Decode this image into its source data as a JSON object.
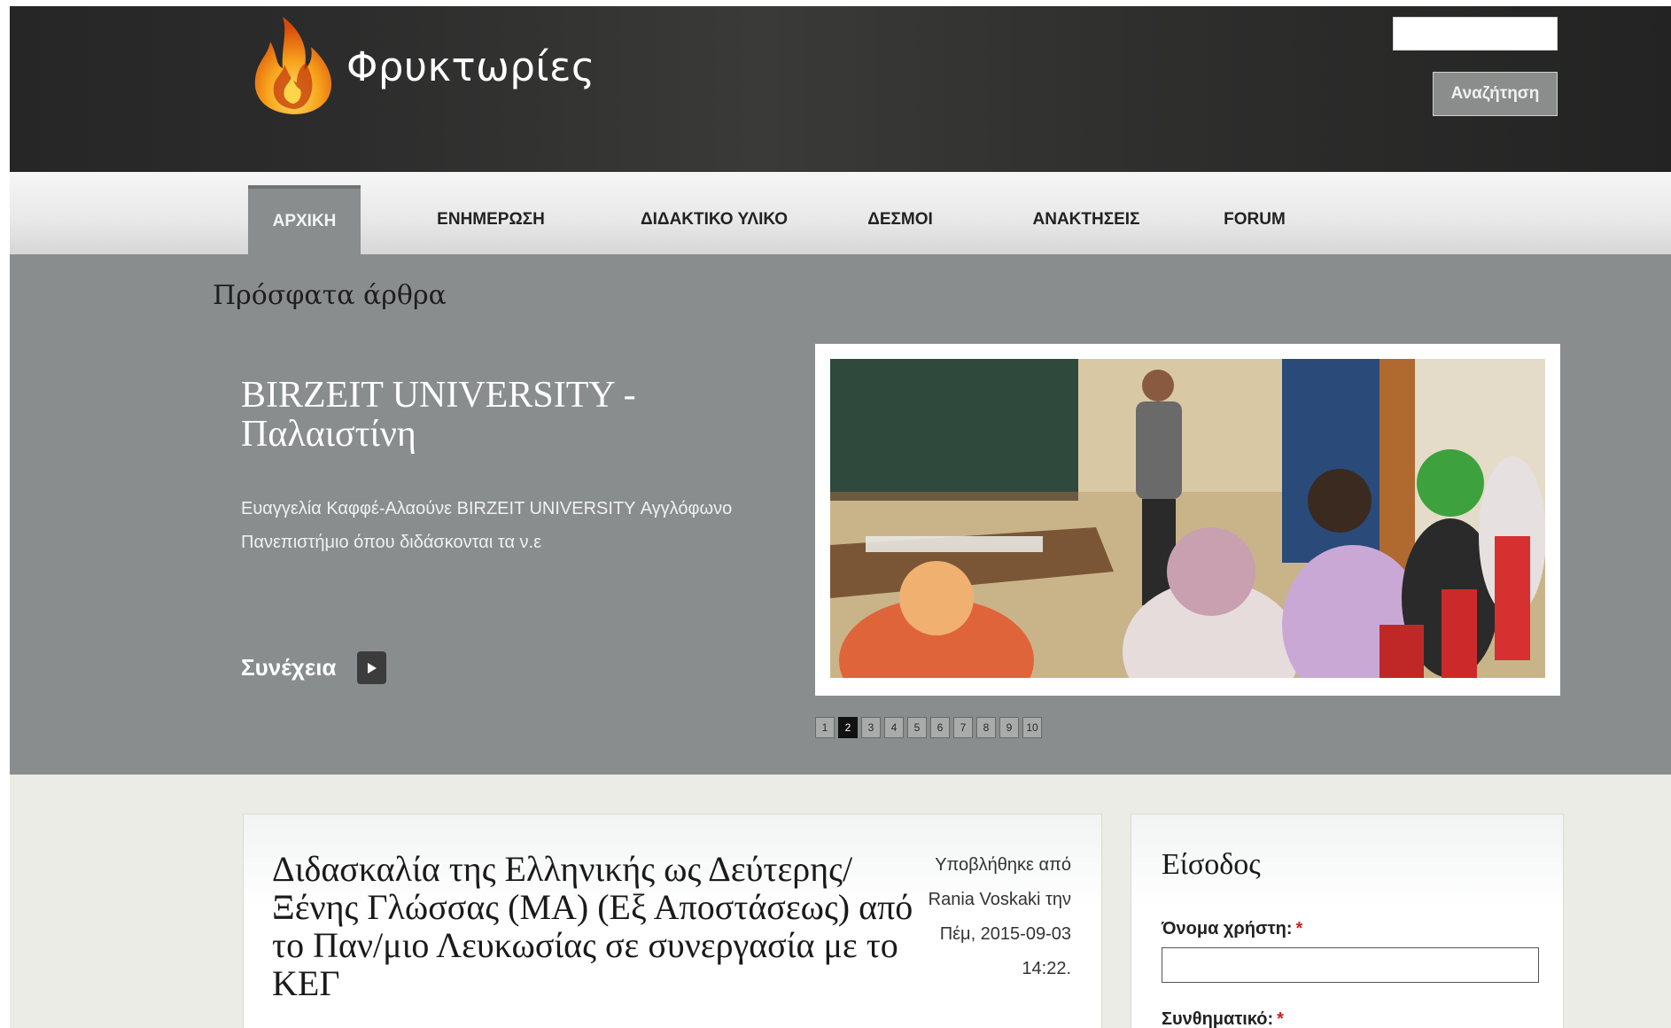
{
  "header": {
    "site_name": "Φρυκτωρίες",
    "search_placeholder": "",
    "search_button": "Αναζήτηση"
  },
  "nav": {
    "items": [
      {
        "label": "ΑΡΧΙΚΗ",
        "active": true
      },
      {
        "label": "ΕΝΗΜΕΡΩΣΗ"
      },
      {
        "label": "ΔΙΔΑΚΤΙΚΟ ΥΛΙΚΟ"
      },
      {
        "label": "ΔΕΣΜΟΙ"
      },
      {
        "label": "ΑΝΑΚΤΗΣΕΙΣ"
      },
      {
        "label": "FORUM"
      }
    ]
  },
  "slides": {
    "section_title": "Πρόσφατα άρθρα",
    "title": "BIRZEIT UNIVERSITY - Παλαιστίνη",
    "text": "Ευαγγελία Καφφέ-Αλαούνε BIRZEIT UNIVERSITY Αγγλόφωνο Πανεπιστήμιο όπου διδάσκονται τα ν.ε",
    "continue_label": "Συνέχεια",
    "pager": [
      "1",
      "2",
      "3",
      "4",
      "5",
      "6",
      "7",
      "8",
      "9",
      "10"
    ],
    "active_page": "2"
  },
  "article": {
    "title": "Διδασκαλία της Ελληνικής ως Δεύτερης/Ξένης Γλώσσας (ΜΑ) (Εξ Αποστάσεως) από το Παν/μιο Λευκωσίας σε συνεργασία με το ΚΕΓ",
    "meta_line1": "Υποβλήθηκε από",
    "meta_line2": "Rania Voskaki την",
    "meta_line3": "Πέμ, 2015-09-03",
    "meta_line4": "14:22."
  },
  "login": {
    "title": "Είσοδος",
    "username_label": "Όνομα χρήστη:",
    "password_label": "Συνθηματικό:",
    "required_mark": "*"
  },
  "colors": {
    "header_bg": "#2a2a2a",
    "slide_bg": "#8a8d8e",
    "content_bg": "#ecece6",
    "required": "#cc2222"
  }
}
